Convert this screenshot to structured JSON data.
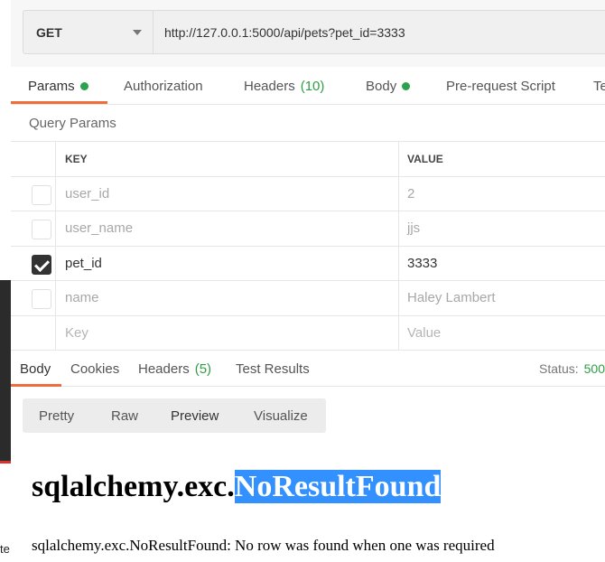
{
  "background_fragment": "te",
  "request": {
    "method": "GET",
    "url": "http://127.0.0.1:5000/api/pets?pet_id=3333"
  },
  "request_tabs": [
    {
      "label": "Params",
      "indicator": "dot",
      "active": true
    },
    {
      "label": "Authorization"
    },
    {
      "label": "Headers",
      "count": "(10)"
    },
    {
      "label": "Body",
      "indicator": "dot"
    },
    {
      "label": "Pre-request Script"
    },
    {
      "label": "Te"
    }
  ],
  "query_params": {
    "title": "Query Params",
    "columns": {
      "key": "KEY",
      "value": "VALUE"
    },
    "rows": [
      {
        "key": "user_id",
        "value": "2",
        "enabled": false
      },
      {
        "key": "user_name",
        "value": "jjs",
        "enabled": false
      },
      {
        "key": "pet_id",
        "value": "3333",
        "enabled": true
      },
      {
        "key": "name",
        "value": "Haley Lambert",
        "enabled": false
      }
    ],
    "placeholder": {
      "key": "Key",
      "value": "Value"
    }
  },
  "response_tabs": [
    {
      "label": "Body",
      "active": true
    },
    {
      "label": "Cookies"
    },
    {
      "label": "Headers",
      "count": "(5)"
    },
    {
      "label": "Test Results"
    }
  ],
  "status": {
    "label": "Status:",
    "code": "500"
  },
  "view_modes": [
    "Pretty",
    "Raw",
    "Preview",
    "Visualize"
  ],
  "active_view_mode": "Preview",
  "preview": {
    "heading_prefix": "sqlalchemy.exc.",
    "heading_selected": "NoResultFound",
    "message": "sqlalchemy.exc.NoResultFound: No row was found when one was required"
  },
  "colors": {
    "accent": "#f26b3a",
    "success": "#2f9e44",
    "selection": "#3390ff"
  }
}
